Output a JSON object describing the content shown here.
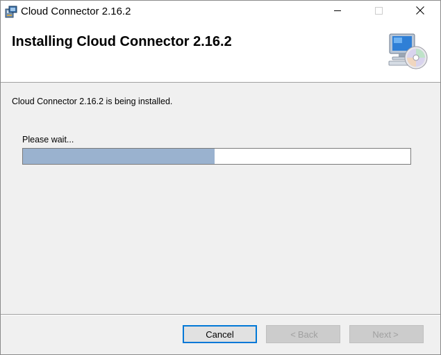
{
  "window": {
    "title": "Cloud Connector 2.16.2",
    "icon": "installer-icon"
  },
  "header": {
    "title": "Installing Cloud Connector 2.16.2",
    "icon": "computer-cd-icon"
  },
  "body": {
    "status": "Cloud Connector 2.16.2 is being installed.",
    "wait_label": "Please wait...",
    "progress_fraction": 0.495
  },
  "buttons": {
    "cancel": "Cancel",
    "back": "Back",
    "next": "Next",
    "back_glyph": "<",
    "next_glyph": ">"
  },
  "colors": {
    "progress_fill": "#9ab2cf",
    "focus_border": "#0078d7"
  }
}
